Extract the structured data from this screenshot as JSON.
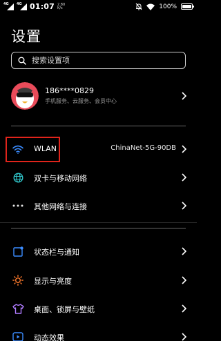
{
  "status_bar": {
    "sim1": "4G",
    "sim2": "4G",
    "time": "01:07",
    "net_speed_value": "2.80",
    "net_speed_unit": "K/s",
    "battery_pct": "100%"
  },
  "page": {
    "title": "设置"
  },
  "search": {
    "placeholder": "搜索设置项"
  },
  "account": {
    "phone": "186****0829",
    "services": "手机服务、云服务、会员中心"
  },
  "network_items": [
    {
      "label": "WLAN",
      "value": "ChinaNet-5G-90DB",
      "icon": "wifi-icon"
    },
    {
      "label": "双卡与移动网络",
      "icon": "globe-icon"
    },
    {
      "label": "其他网络与连接",
      "icon": "more-dots-icon"
    }
  ],
  "display_items": [
    {
      "label": "状态栏与通知",
      "icon": "statusbar-icon"
    },
    {
      "label": "显示与亮度",
      "icon": "brightness-icon"
    },
    {
      "label": "桌面、锁屏与壁纸",
      "icon": "tshirt-icon"
    },
    {
      "label": "动态效果",
      "icon": "motion-icon"
    }
  ],
  "colors": {
    "background": "#000000",
    "highlight": "#e0241b",
    "accent_blue": "#3b8cff",
    "accent_teal": "#2fc3c8",
    "accent_orange": "#ff7a2c",
    "accent_purple": "#b07cff"
  }
}
